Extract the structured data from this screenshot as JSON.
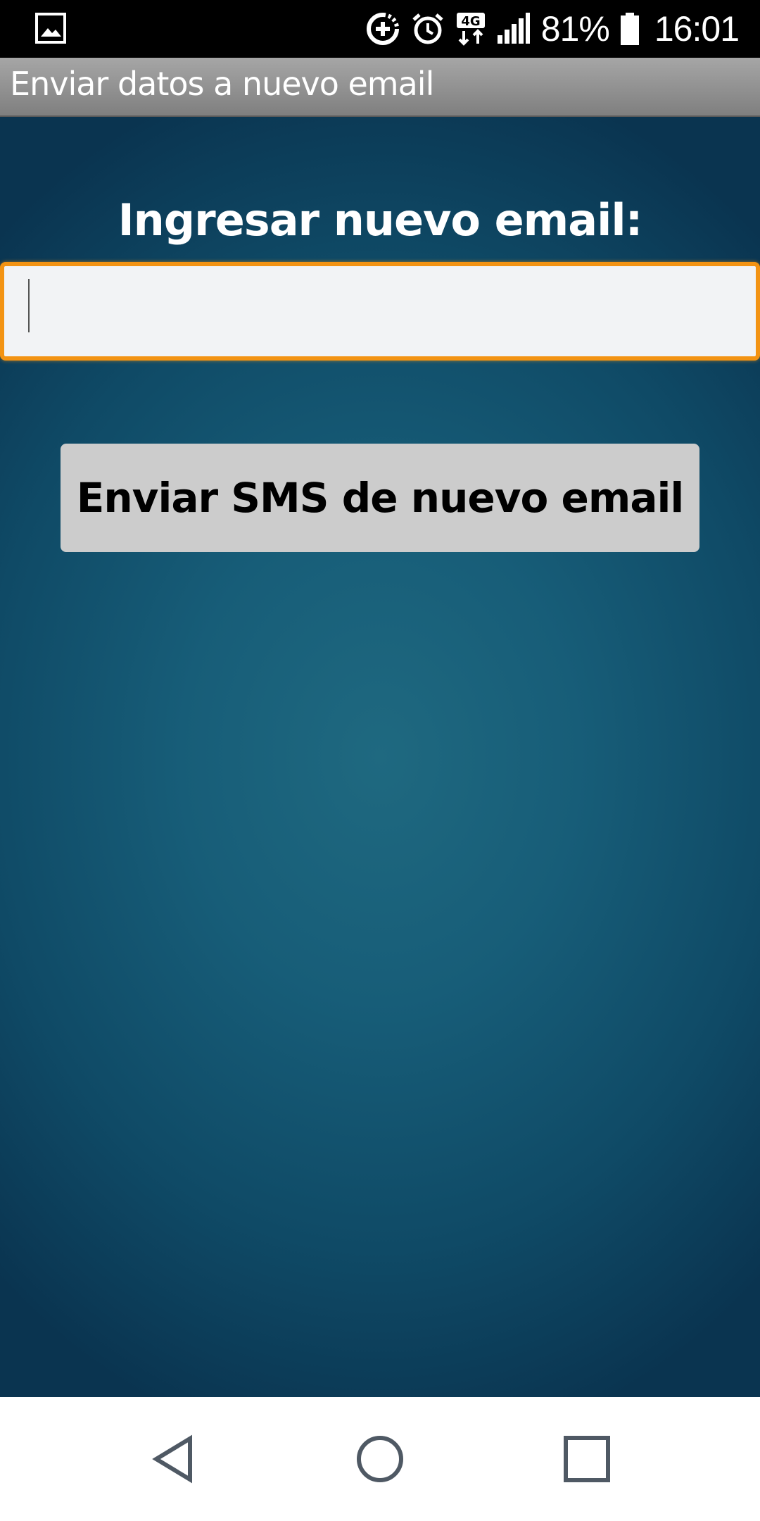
{
  "status_bar": {
    "battery_percent": "81%",
    "time": "16:01",
    "network_type": "4G",
    "icons": [
      "gallery-icon",
      "data-saver-icon",
      "alarm-icon",
      "4g-data-icon",
      "signal-icon",
      "battery-icon"
    ]
  },
  "title_bar": {
    "title": "Enviar datos a nuevo email"
  },
  "form": {
    "email_label": "Ingresar nuevo email:",
    "email_value": "",
    "email_placeholder": "",
    "send_button_label": "Enviar SMS de nuevo email"
  },
  "nav_bar": {
    "icons": [
      "back-icon",
      "home-icon",
      "recents-icon"
    ]
  },
  "colors": {
    "accent_focus": "#f39313",
    "background_center": "#1f6980",
    "background_edge": "#0a3450",
    "title_bar": "#8f8f8f",
    "button": "#cccccc"
  }
}
